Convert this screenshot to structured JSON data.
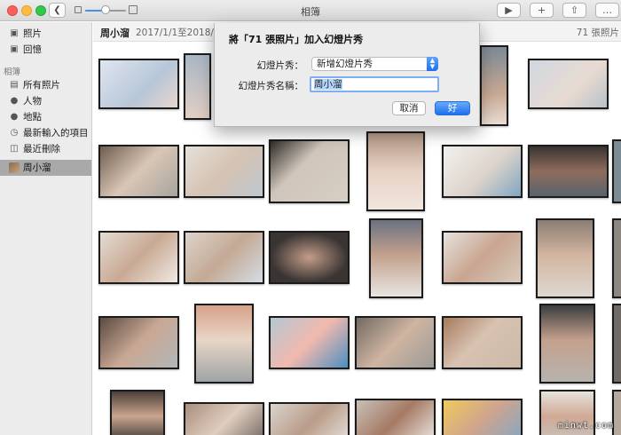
{
  "window": {
    "title": "相簿"
  },
  "sidebar": {
    "items_top": [
      {
        "label": "照片",
        "icon": "photos-icon"
      },
      {
        "label": "回憶",
        "icon": "memories-icon"
      }
    ],
    "section_title": "相簿",
    "items_album": [
      {
        "label": "所有照片",
        "icon": "folder-icon"
      },
      {
        "label": "人物",
        "icon": "person-icon"
      },
      {
        "label": "地點",
        "icon": "pin-icon"
      },
      {
        "label": "最新輸入的項目",
        "icon": "clock-icon"
      },
      {
        "label": "最近刪除",
        "icon": "trash-icon"
      },
      {
        "label": "周小溜",
        "icon": "album-thumb-icon",
        "selected": true
      }
    ]
  },
  "header": {
    "album_title": "周小溜",
    "date_range": "2017/1/1至2018/8/31",
    "count": "71 張照片"
  },
  "dialog": {
    "title": "將「71 張照片」加入幻燈片秀",
    "slideshow_label": "幻燈片秀：",
    "slideshow_value": "新增幻燈片秀",
    "name_label": "幻燈片秀名稱：",
    "name_value": "周小溜",
    "cancel_label": "取消",
    "ok_label": "好"
  },
  "watermark": "minwt.com",
  "colors": {
    "accent": "#1c70ef",
    "selection": "#a9a9a9"
  }
}
